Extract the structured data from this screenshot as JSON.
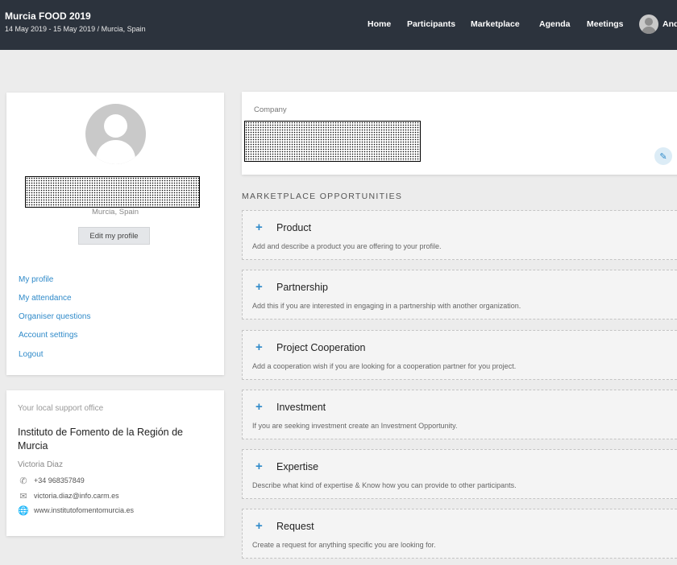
{
  "header": {
    "event_title": "Murcia FOOD 2019",
    "event_dates": "14 May 2019 - 15 May 2019 / Murcia, Spain",
    "nav": [
      "Home",
      "Participants",
      "Marketplace",
      "Agenda",
      "Meetings"
    ],
    "user_name": "And"
  },
  "profile": {
    "location": "Murcia, Spain",
    "edit_label": "Edit my profile",
    "links": [
      "My profile",
      "My attendance",
      "Organiser questions",
      "Account settings",
      "Logout"
    ]
  },
  "support": {
    "label": "Your local support office",
    "org": "Instituto de Fomento de la Región de Murcia",
    "person": "Victoria Diaz",
    "phone": "+34 968357849",
    "email": "victoria.diaz@info.carm.es",
    "website": "www.institutofomentomurcia.es"
  },
  "company": {
    "label": "Company"
  },
  "marketplace": {
    "title": "MARKETPLACE OPPORTUNITIES",
    "items": [
      {
        "title": "Product",
        "desc": "Add and describe a product you are offering to your profile."
      },
      {
        "title": "Partnership",
        "desc": "Add this if you are interested in engaging in a partnership with another organization."
      },
      {
        "title": "Project Cooperation",
        "desc": "Add a cooperation wish if you are looking for a cooperation partner for you project."
      },
      {
        "title": "Investment",
        "desc": "If you are seeking investment create an Investment Opportunity."
      },
      {
        "title": "Expertise",
        "desc": "Describe what kind of expertise & Know how you can provide to other participants."
      },
      {
        "title": "Request",
        "desc": "Create a request for anything specific you are looking for."
      }
    ]
  },
  "colors": {
    "topbar": "#2c333d",
    "link": "#2f8ac9",
    "background": "#ececec"
  },
  "icons": {
    "phone": "phone-icon",
    "email": "email-icon",
    "website": "globe-icon",
    "edit": "pencil-icon",
    "add": "plus-icon"
  }
}
